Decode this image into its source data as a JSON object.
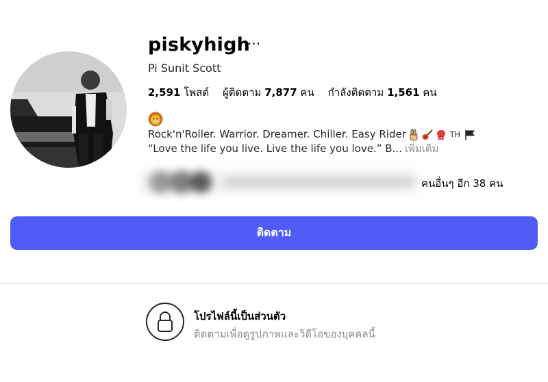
{
  "profile": {
    "username": "piskyhigh",
    "more_options": "···",
    "full_name": "Pi Sunit Scott",
    "stats": {
      "posts_count": "2,591",
      "posts_label": "โพสต์",
      "followers_label": "ผู้ติดตาม",
      "followers_count": "7,877",
      "followers_unit": "คน",
      "following_label": "กำลังติดตาม",
      "following_count": "1,561",
      "following_unit": "คน"
    },
    "bio": {
      "emoji": "lion-face",
      "line1": "Rock'n'Roller. Warrior. Dreamer. Chiller. Easy Rider",
      "line1_tag": "TH",
      "line2": "“Love the life you live. Live the life you love.” B...",
      "more_label": "เพิ่มเติม"
    },
    "followed_by_extra": "คนอื่นๆ อีก 38 คน"
  },
  "actions": {
    "follow_label": "ติดตาม"
  },
  "private": {
    "title": "โปรไฟล์นี้เป็นส่วนตัว",
    "subtitle": "ติดตามเพื่อดูรูปภาพและวิดีโอของบุคคลนี้"
  },
  "colors": {
    "follow_button": "#4f5cf5",
    "secondary_text": "#8e8e8e"
  }
}
